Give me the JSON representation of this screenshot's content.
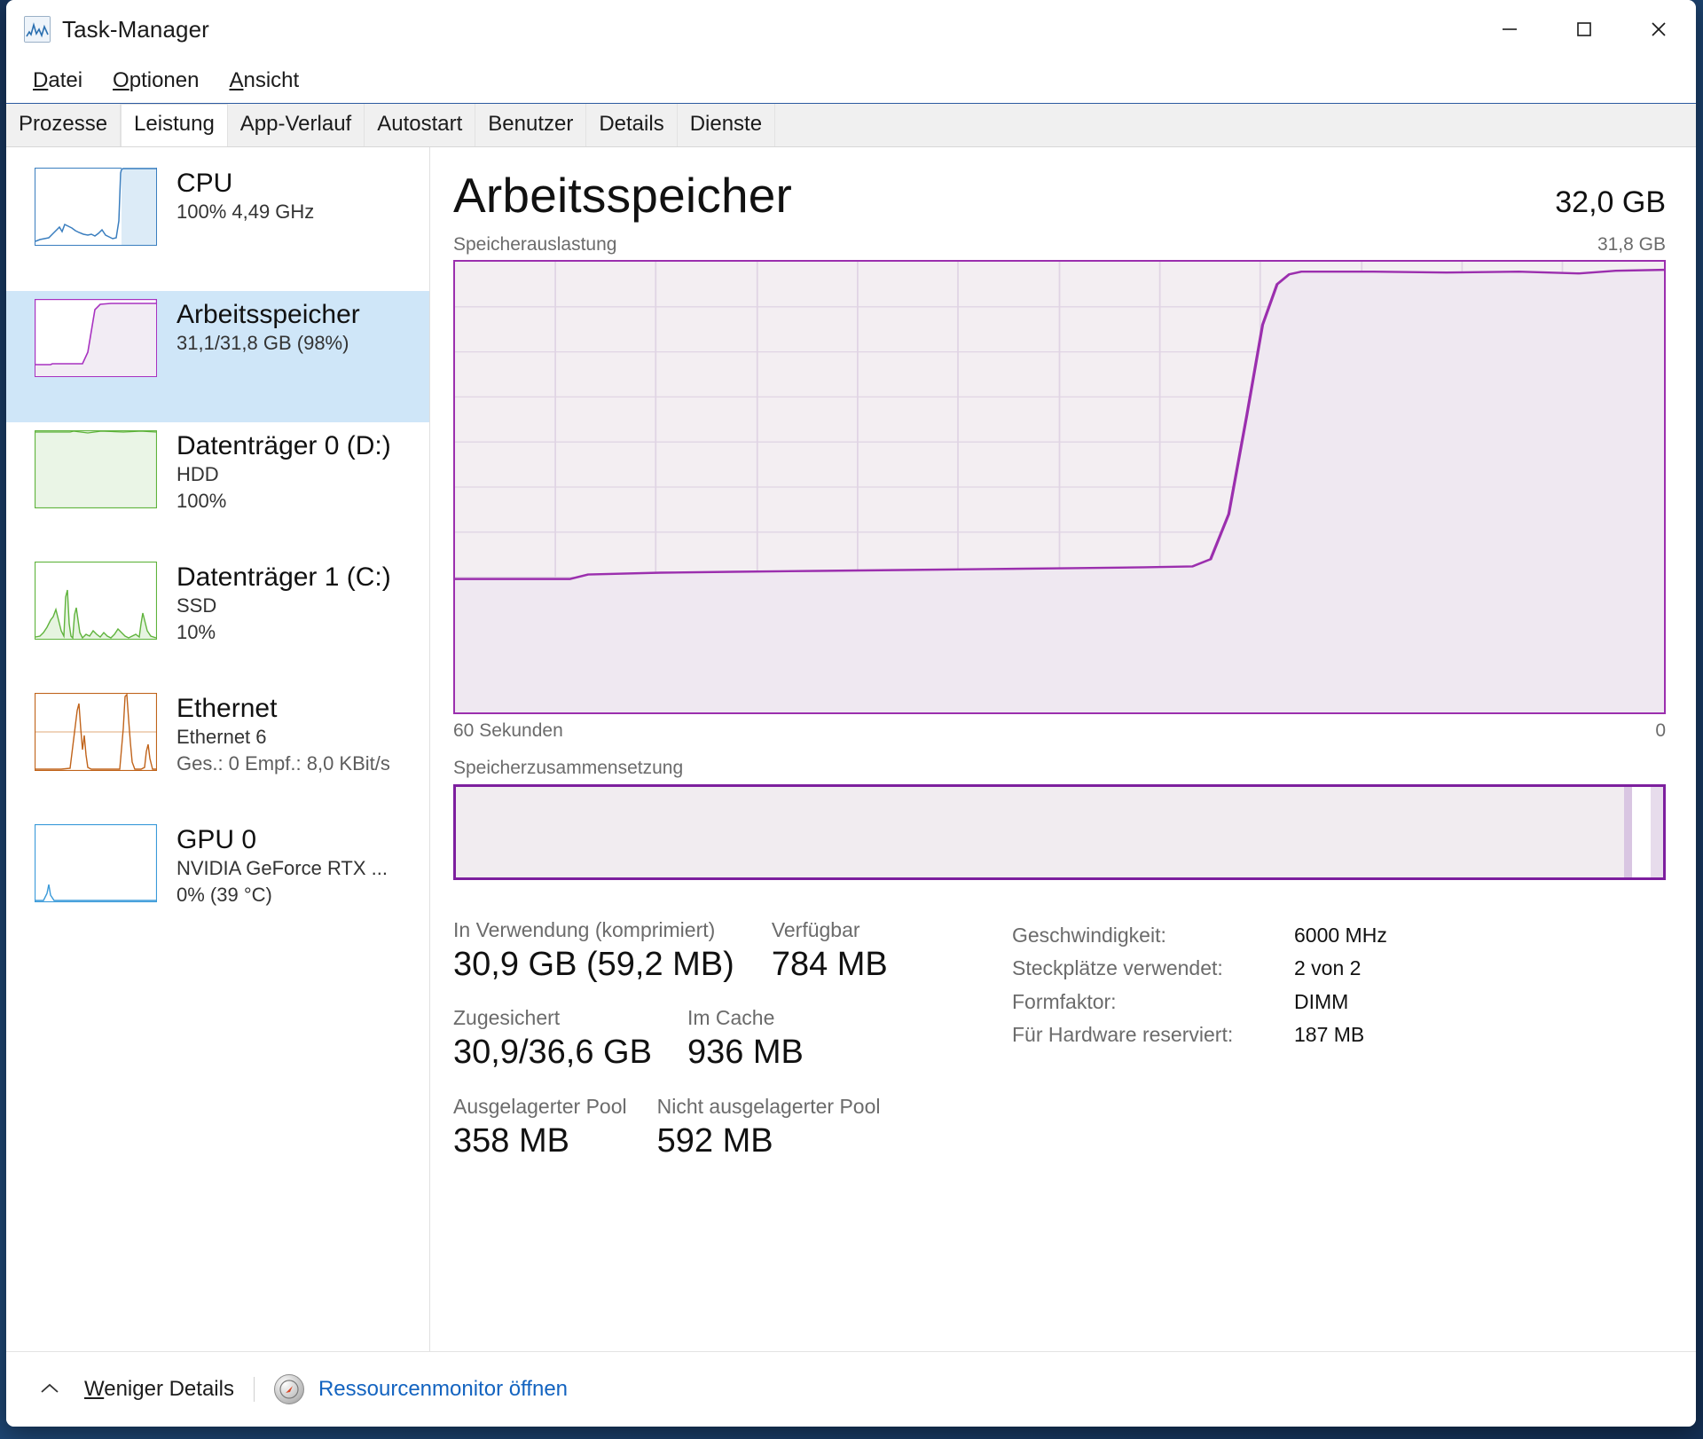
{
  "window": {
    "title": "Task-Manager",
    "app_icon": "taskmanager-icon",
    "minimize": "minimize-icon",
    "maximize": "maximize-icon",
    "close": "close-icon"
  },
  "menu": [
    {
      "label": "Datei",
      "accel": "D"
    },
    {
      "label": "Optionen",
      "accel": "O"
    },
    {
      "label": "Ansicht",
      "accel": "A"
    }
  ],
  "tabs": [
    {
      "label": "Prozesse",
      "active": false
    },
    {
      "label": "Leistung",
      "active": true
    },
    {
      "label": "App-Verlauf",
      "active": false
    },
    {
      "label": "Autostart",
      "active": false
    },
    {
      "label": "Benutzer",
      "active": false
    },
    {
      "label": "Details",
      "active": false
    },
    {
      "label": "Dienste",
      "active": false
    }
  ],
  "sidebar": {
    "items": [
      {
        "name": "CPU",
        "sub1": "100%  4,49 GHz",
        "sub2": "",
        "color": "#3a7ebf",
        "selected": false
      },
      {
        "name": "Arbeitsspeicher",
        "sub1": "31,1/31,8 GB (98%)",
        "sub2": "",
        "color": "#a832c0",
        "selected": true
      },
      {
        "name": "Datenträger 0 (D:)",
        "sub1": "HDD",
        "sub2": "100%",
        "color": "#5fb33c",
        "selected": false
      },
      {
        "name": "Datenträger 1 (C:)",
        "sub1": "SSD",
        "sub2": "10%",
        "color": "#5fb33c",
        "selected": false
      },
      {
        "name": "Ethernet",
        "sub1": "Ethernet 6",
        "sub2": "Ges.: 0  Empf.: 8,0 KBit/s",
        "color": "#c0631a",
        "selected": false
      },
      {
        "name": "GPU 0",
        "sub1": "NVIDIA GeForce RTX ...",
        "sub2": "0%  (39 °C)",
        "color": "#3a9ad9",
        "selected": false
      }
    ]
  },
  "main": {
    "title": "Arbeitsspeicher",
    "total": "32,0 GB",
    "graph_caption_left": "Speicherauslastung",
    "graph_caption_right": "31,8 GB",
    "axis_left": "60 Sekunden",
    "axis_right": "0",
    "composition_caption": "Speicherzusammensetzung",
    "accent_color": "#9b2fae",
    "stats": {
      "in_use_label": "In Verwendung (komprimiert)",
      "in_use_value": "30,9 GB (59,2 MB)",
      "available_label": "Verfügbar",
      "available_value": "784 MB",
      "committed_label": "Zugesichert",
      "committed_value": "30,9/36,6 GB",
      "cached_label": "Im Cache",
      "cached_value": "936 MB",
      "paged_pool_label": "Ausgelagerter Pool",
      "paged_pool_value": "358 MB",
      "nonpaged_pool_label": "Nicht ausgelagerter Pool",
      "nonpaged_pool_value": "592 MB"
    },
    "specs": [
      {
        "key": "Geschwindigkeit:",
        "value": "6000 MHz"
      },
      {
        "key": "Steckplätze verwendet:",
        "value": "2 von 2"
      },
      {
        "key": "Formfaktor:",
        "value": "DIMM"
      },
      {
        "key": "Für Hardware reserviert:",
        "value": "187 MB"
      }
    ]
  },
  "chart_data": {
    "type": "area",
    "title": "Speicherauslastung",
    "xlabel": "60 Sekunden",
    "ylabel": "Speicherauslastung",
    "ylim": [
      0,
      31.8
    ],
    "ymax_label": "31,8 GB",
    "xlim_labels": [
      "60 Sekunden",
      "0"
    ],
    "grid": true,
    "series": [
      {
        "name": "Arbeitsspeicher",
        "unit": "GB",
        "color": "#9b2fae",
        "x": [
          0,
          2,
          4,
          6,
          8,
          10,
          12,
          14,
          16,
          18,
          20,
          22,
          24,
          26,
          28,
          30,
          32,
          34,
          36,
          38,
          40,
          42,
          44,
          46,
          48,
          50,
          52,
          54,
          56,
          58,
          60,
          62,
          64,
          66,
          68,
          70,
          72,
          74,
          76,
          78,
          80,
          82,
          84,
          86,
          88,
          90,
          92,
          94,
          96,
          98,
          100
        ],
        "values": [
          9.4,
          9.4,
          9.4,
          9.4,
          9.4,
          9.4,
          9.4,
          9.5,
          9.8,
          9.9,
          9.9,
          9.9,
          9.9,
          9.9,
          9.9,
          10.0,
          10.0,
          10.0,
          10.0,
          10.1,
          10.1,
          10.1,
          10.1,
          10.1,
          10.2,
          10.2,
          10.2,
          10.2,
          10.2,
          10.2,
          10.2,
          10.3,
          10.3,
          10.3,
          10.3,
          10.3,
          10.3,
          10.4,
          10.4,
          12.0,
          20.0,
          28.0,
          30.6,
          31.2,
          31.3,
          31.3,
          31.3,
          31.3,
          31.3,
          31.2,
          31.3
        ]
      }
    ]
  },
  "composition": {
    "segments": [
      {
        "name": "in-use",
        "percent": 96.8,
        "color": "#f1ecf0"
      },
      {
        "name": "modified",
        "percent": 0.6,
        "color": "#d9c6e2"
      },
      {
        "name": "standby",
        "percent": 1.6,
        "color": "#ffffff"
      },
      {
        "name": "free",
        "percent": 1.0,
        "color": "#e7dcec"
      }
    ]
  },
  "footer": {
    "chevron_icon": "chevron-up-icon",
    "less_details": "Weniger Details",
    "less_details_accel": "W",
    "resource_icon": "resource-monitor-icon",
    "resource_link": "Ressourcenmonitor öffnen"
  }
}
